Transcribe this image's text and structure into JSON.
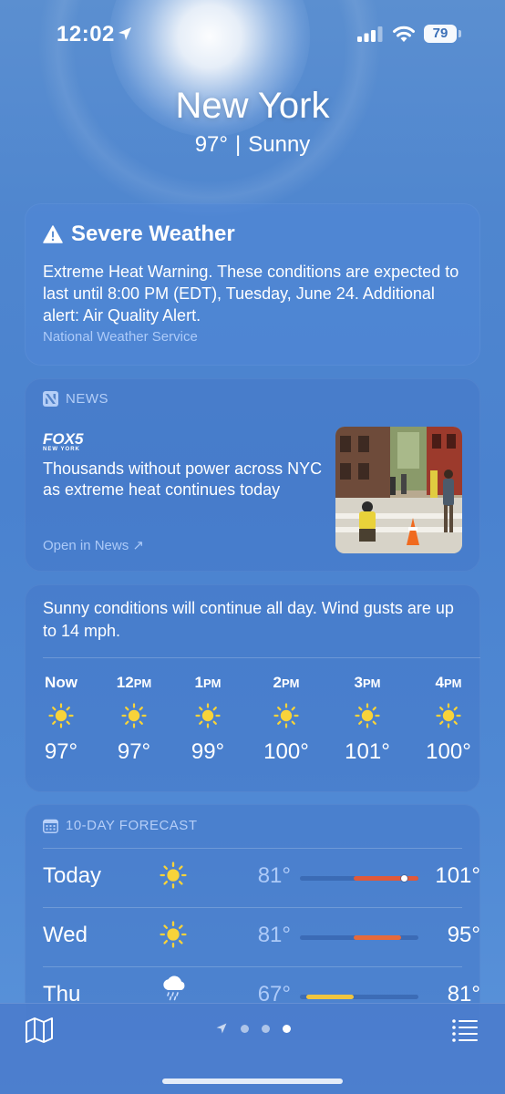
{
  "status_bar": {
    "time": "12:02",
    "battery": "79"
  },
  "header": {
    "city": "New York",
    "temperature": "97°",
    "separator": "|",
    "condition": "Sunny"
  },
  "severe_weather": {
    "title": "Severe Weather",
    "body": "Extreme Heat Warning. These conditions are expected to last until 8:00 PM (EDT), Tuesday, June 24. Additional alert: Air Quality Alert.",
    "source": "National Weather Service",
    "icon": "warning-icon"
  },
  "news": {
    "label": "NEWS",
    "publisher_logo": "FOX5",
    "publisher_sub": "NEW YORK",
    "headline": "Thousands without power across NYC as extreme heat continues today",
    "open_label": "Open in News ↗",
    "icon": "news-icon"
  },
  "hourly": {
    "summary": "Sunny conditions will continue all day. Wind gusts are up to 14 mph.",
    "hours": [
      {
        "label": "Now",
        "suffix": "",
        "temp": "97°",
        "icon": "sun-icon"
      },
      {
        "label": "12",
        "suffix": "PM",
        "temp": "97°",
        "icon": "sun-icon"
      },
      {
        "label": "1",
        "suffix": "PM",
        "temp": "99°",
        "icon": "sun-icon"
      },
      {
        "label": "2",
        "suffix": "PM",
        "temp": "100°",
        "icon": "sun-icon"
      },
      {
        "label": "3",
        "suffix": "PM",
        "temp": "101°",
        "icon": "sun-icon"
      },
      {
        "label": "4",
        "suffix": "PM",
        "temp": "100°",
        "icon": "sun-icon"
      }
    ]
  },
  "forecast": {
    "label": "10-DAY FORECAST",
    "icon": "calendar-icon",
    "days": [
      {
        "day": "Today",
        "icon": "sun-icon",
        "low": "81°",
        "high": "101°",
        "range_start": 0.45,
        "range_end": 1.0,
        "current": 0.88,
        "color": "#e0593a"
      },
      {
        "day": "Wed",
        "icon": "sun-icon",
        "low": "81°",
        "high": "95°",
        "range_start": 0.45,
        "range_end": 0.85,
        "color": "#e66a3b"
      },
      {
        "day": "Thu",
        "icon": "rain-cloud-icon",
        "low": "67°",
        "high": "81°",
        "range_start": 0.05,
        "range_end": 0.45,
        "color": "#f0c53f"
      }
    ]
  },
  "toolbar": {
    "map_icon": "map-icon",
    "list_icon": "list-icon",
    "pages": 3,
    "active_page": 3
  }
}
